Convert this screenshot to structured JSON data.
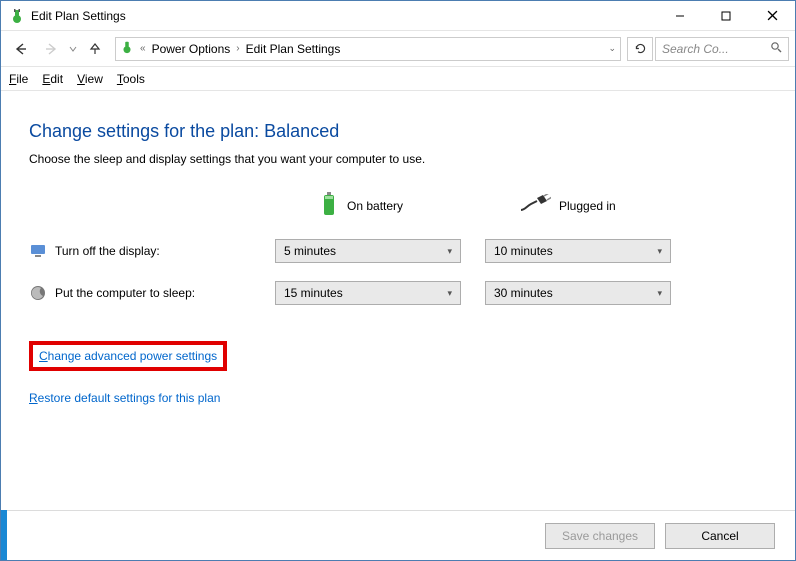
{
  "window": {
    "title": "Edit Plan Settings"
  },
  "breadcrumb": {
    "item1": "Power Options",
    "item2": "Edit Plan Settings"
  },
  "search": {
    "placeholder": "Search Co..."
  },
  "menu": {
    "file": "File",
    "edit": "Edit",
    "view": "View",
    "tools": "Tools"
  },
  "page": {
    "title": "Change settings for the plan: Balanced",
    "desc": "Choose the sleep and display settings that you want your computer to use."
  },
  "columns": {
    "battery": "On battery",
    "plugged": "Plugged in"
  },
  "rows": {
    "display_label": "Turn off the display:",
    "display_battery": "5 minutes",
    "display_plugged": "10 minutes",
    "sleep_label": "Put the computer to sleep:",
    "sleep_battery": "15 minutes",
    "sleep_plugged": "30 minutes"
  },
  "links": {
    "advanced": "Change advanced power settings",
    "restore": "Restore default settings for this plan"
  },
  "buttons": {
    "save": "Save changes",
    "cancel": "Cancel"
  }
}
